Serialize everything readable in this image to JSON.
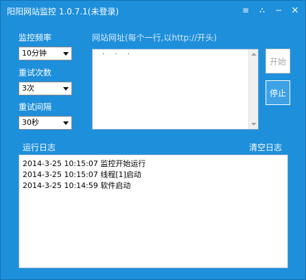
{
  "window": {
    "title": "阳阳网站监控 1.0.7.1(未登录)",
    "controls": {
      "settings": "≡",
      "skin": "⛬",
      "minimize": "−",
      "close": "×"
    }
  },
  "settings": {
    "frequency_label": "监控频率",
    "frequency_value": "10分钟",
    "retry_count_label": "重试次数",
    "retry_count_value": "3次",
    "retry_interval_label": "重试间隔",
    "retry_interval_value": "30秒"
  },
  "urls": {
    "label": "网站网址(每个一行,以http://开头)",
    "content": "·  ·  ·"
  },
  "buttons": {
    "start": "开始",
    "stop": "停止"
  },
  "log": {
    "label": "运行日志",
    "clear_label": "清空日志",
    "lines": [
      "2014-3-25 10:15:07 监控开始运行",
      "2014-3-25 10:15:07 线程[1]启动",
      "2014-3-25 10:14:59 软件启动"
    ]
  }
}
